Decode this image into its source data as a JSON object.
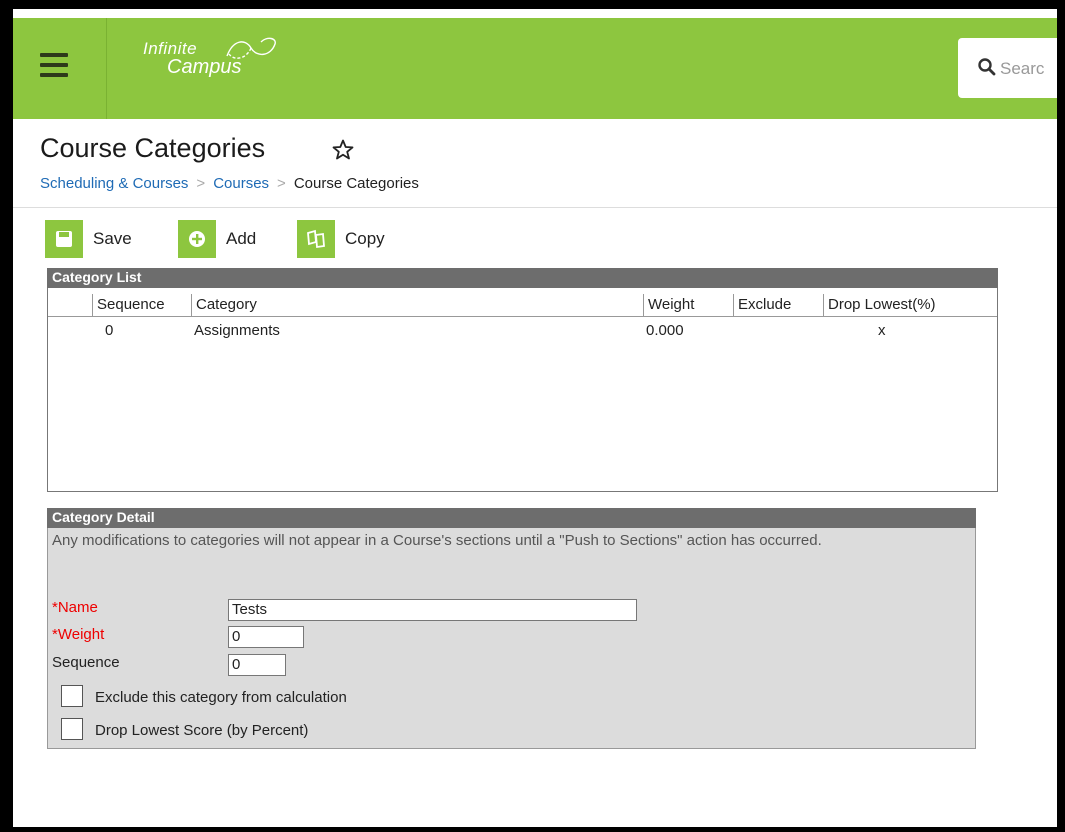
{
  "header": {
    "logo_line1": "Infinite",
    "logo_line2": "Campus",
    "search_placeholder": "Searc",
    "bar_color": "#8dc63f"
  },
  "page": {
    "title": "Course Categories",
    "breadcrumb": [
      "Scheduling & Courses",
      "Courses",
      "Course Categories"
    ]
  },
  "toolbar": {
    "save_label": "Save",
    "add_label": "Add",
    "copy_label": "Copy"
  },
  "category_list": {
    "heading": "Category List",
    "columns": [
      "Sequence",
      "Category",
      "Weight",
      "Exclude",
      "Drop Lowest(%)"
    ],
    "rows": [
      {
        "sequence": "0",
        "category": "Assignments",
        "weight": "0.000",
        "exclude": "",
        "drop_lowest": "x"
      }
    ]
  },
  "category_detail": {
    "heading": "Category Detail",
    "note": "Any modifications to categories will not appear in a Course's sections until a \"Push to Sections\" action has occurred.",
    "name_label": "Name",
    "name_value": "Tests",
    "weight_label": "Weight",
    "weight_value": "0",
    "sequence_label": "Sequence",
    "sequence_value": "0",
    "exclude_label": "Exclude this category from calculation",
    "drop_label": "Drop Lowest Score (by Percent)",
    "exclude_checked": false,
    "drop_checked": false
  }
}
